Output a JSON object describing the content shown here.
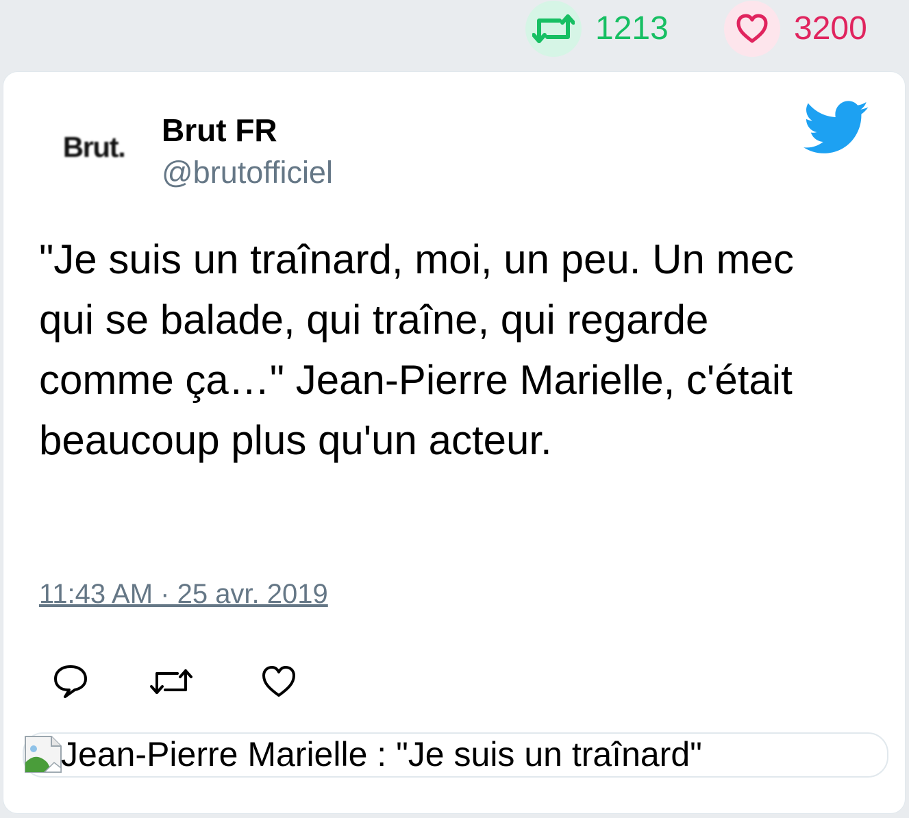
{
  "stats": {
    "retweets": "1213",
    "likes": "3200",
    "retweet_color": "#17bf63",
    "like_color": "#e0245e",
    "retweet_icon": "retweet-icon",
    "like_icon": "heart-icon"
  },
  "tweet": {
    "avatar_text": "Brut.",
    "author_name": "Brut FR",
    "author_handle": "@brutofficiel",
    "brand_icon": "twitter-bird-icon",
    "brand_color": "#1da1f2",
    "text": "\"Je suis un traînard, moi, un peu. Un mec qui se balade, qui traîne, qui regarde comme ça…\" Jean-Pierre Marielle, c'était beaucoup plus qu'un acteur.",
    "timestamp": "11:43 AM · 25 avr. 2019",
    "actions": [
      "reply-icon",
      "retweet-icon",
      "heart-icon"
    ]
  },
  "link_card": {
    "image_icon": "broken-image-icon",
    "title": "Jean-Pierre Marielle : \"Je suis un traînard\""
  }
}
